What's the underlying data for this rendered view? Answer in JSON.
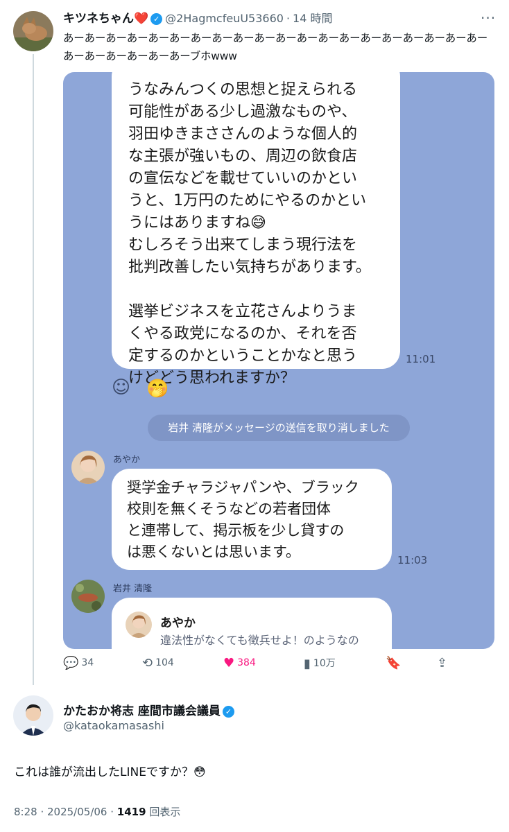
{
  "tweet1": {
    "display_name": "キツネちゃん❤️",
    "handle": "@2HagmcfeuU53660",
    "separator": "·",
    "time": "14 時間",
    "more_icon": "···",
    "text": "あーあーあーあーあーあーあーあーあーあーあーあーあーあーあーあーあーあーあーあーあーあーあーあーあーあーブホwww"
  },
  "chat": {
    "message1": {
      "text": "うなみんつくの思想と捉えられる\n可能性がある少し過激なものや、\n羽田ゆきまささんのような個人的\nな主張が強いもの、周辺の飲食店\nの宣伝などを載せていいのかとい\nうと、1万円のためにやるのかとい\nうにはありますね😅\nむしろそう出来てしまう現行法を\n批判改善したい気持ちがあります。\n\n選挙ビジネスを立花さんよりうま\nくやる政党になるのか、それを否\n定するのかということかなと思う\nけどどう思われますか？",
      "time": "11:01"
    },
    "system_message": "岩井 清隆がメッセージの送信を取り消しました",
    "message2": {
      "sender": "あやか",
      "text": "奨学金チャラジャパンや、ブラック\n校則を無くそうなどの若者団体\nと連帯して、掲示板を少し貸すの\nは悪くないとは思います。",
      "time": "11:03"
    },
    "message3": {
      "sender": "岩井 清隆",
      "quote_name": "あやか",
      "quote_text": "違法性がなくても徴兵せよ！のようなの"
    }
  },
  "actions": {
    "replies": "34",
    "reposts": "104",
    "likes": "384",
    "views": "10万"
  },
  "tweet2": {
    "display_name": "かたおか将志 座間市議会議員",
    "handle": "@kataokamasashi",
    "text": "これは誰が流出したLINEですか？😳",
    "time": "8:28",
    "date": "2025/05/06",
    "views_count": "1419",
    "views_label": "回表示"
  },
  "colors": {
    "accent": "#1d9bf0",
    "like": "#f91880",
    "line_background": "#8ea6d8"
  }
}
